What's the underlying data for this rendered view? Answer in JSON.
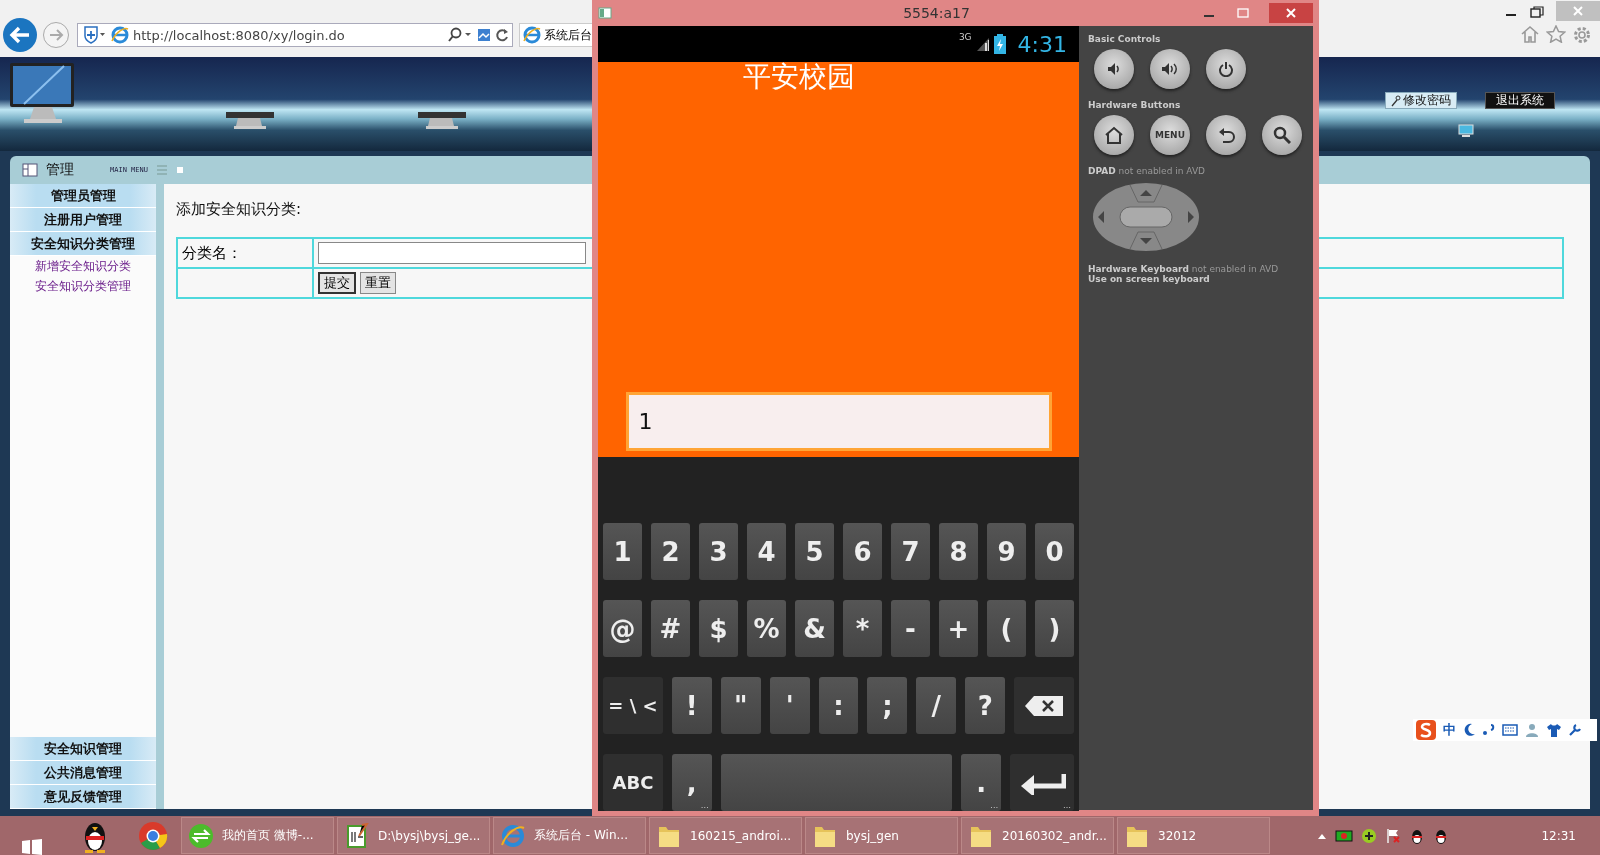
{
  "browser": {
    "address": "http://localhost:8080/xy/login.do",
    "tab_title": "系统后台"
  },
  "page": {
    "header_buttons": [
      {
        "label": "修改密码",
        "kind": "light"
      },
      {
        "label": "退出系统",
        "kind": "dark"
      }
    ],
    "menu": {
      "title": "管理",
      "subtitle": "MAIN MENU",
      "top_items": [
        {
          "label": "管理员管理"
        },
        {
          "label": "注册用户管理"
        },
        {
          "label": "安全知识分类管理",
          "children": [
            {
              "label": "新增安全知识分类"
            },
            {
              "label": "安全知识分类管理"
            }
          ]
        }
      ],
      "bottom_items": [
        {
          "label": "安全知识管理"
        },
        {
          "label": "公共消息管理"
        },
        {
          "label": "意见反馈管理"
        }
      ]
    },
    "form": {
      "title": "添加安全知识分类:",
      "field_label": "分类名：",
      "buttons": [
        "提交",
        "重置"
      ]
    }
  },
  "emulator": {
    "title": "5554:a17",
    "network": "3G",
    "time": "4:31",
    "app_title": "平安校园",
    "input_value": "1",
    "keyboard_rows": [
      [
        {
          "kind": "char",
          "label": "1"
        },
        {
          "kind": "char",
          "label": "2"
        },
        {
          "kind": "char",
          "label": "3"
        },
        {
          "kind": "char",
          "label": "4"
        },
        {
          "kind": "char",
          "label": "5"
        },
        {
          "kind": "char",
          "label": "6"
        },
        {
          "kind": "char",
          "label": "7"
        },
        {
          "kind": "char",
          "label": "8"
        },
        {
          "kind": "char",
          "label": "9"
        },
        {
          "kind": "char",
          "label": "0"
        }
      ],
      [
        {
          "kind": "char",
          "label": "@"
        },
        {
          "kind": "char",
          "label": "#"
        },
        {
          "kind": "char",
          "label": "$"
        },
        {
          "kind": "char",
          "label": "%"
        },
        {
          "kind": "char",
          "label": "&"
        },
        {
          "kind": "char",
          "label": "*"
        },
        {
          "kind": "char",
          "label": "-"
        },
        {
          "kind": "char",
          "label": "+"
        },
        {
          "kind": "char",
          "label": "("
        },
        {
          "kind": "char",
          "label": ")"
        }
      ],
      [
        {
          "kind": "fn",
          "label": "= \\ <"
        },
        {
          "kind": "char",
          "label": "!"
        },
        {
          "kind": "char",
          "label": "\""
        },
        {
          "kind": "char",
          "label": "'"
        },
        {
          "kind": "char",
          "label": ":"
        },
        {
          "kind": "char",
          "label": ";"
        },
        {
          "kind": "char",
          "label": "/"
        },
        {
          "kind": "char",
          "label": "?"
        },
        {
          "kind": "backspace"
        }
      ],
      [
        {
          "kind": "fn",
          "label": "ABC"
        },
        {
          "kind": "char",
          "label": ",",
          "hint": "…"
        },
        {
          "kind": "space"
        },
        {
          "kind": "char",
          "label": ".",
          "hint": "…"
        },
        {
          "kind": "enter",
          "hint": "…"
        }
      ]
    ],
    "controls": {
      "basic_label": "Basic Controls",
      "hardware_label": "Hardware Buttons",
      "menu_label": "MENU",
      "dpad_note": "**DPAD** not enabled in AVD",
      "keyboard_note": "**Hardware Keyboard** not enabled in AVD",
      "keyboard_hint": "Use on screen keyboard"
    }
  },
  "ime": {
    "mode": "中"
  },
  "taskbar": {
    "items": [
      {
        "kind": "web",
        "label": "我的首页 微博-..."
      },
      {
        "kind": "notepad",
        "label": "D:\\bysj\\bysj_ge..."
      },
      {
        "kind": "ie",
        "label": "系统后台 - Win..."
      },
      {
        "kind": "folder",
        "label": "160215_androi..."
      },
      {
        "kind": "folder",
        "label": "bysj_gen"
      },
      {
        "kind": "folder",
        "label": "20160302_andr..."
      },
      {
        "kind": "folder",
        "label": "32012"
      }
    ],
    "time": "12:31"
  }
}
